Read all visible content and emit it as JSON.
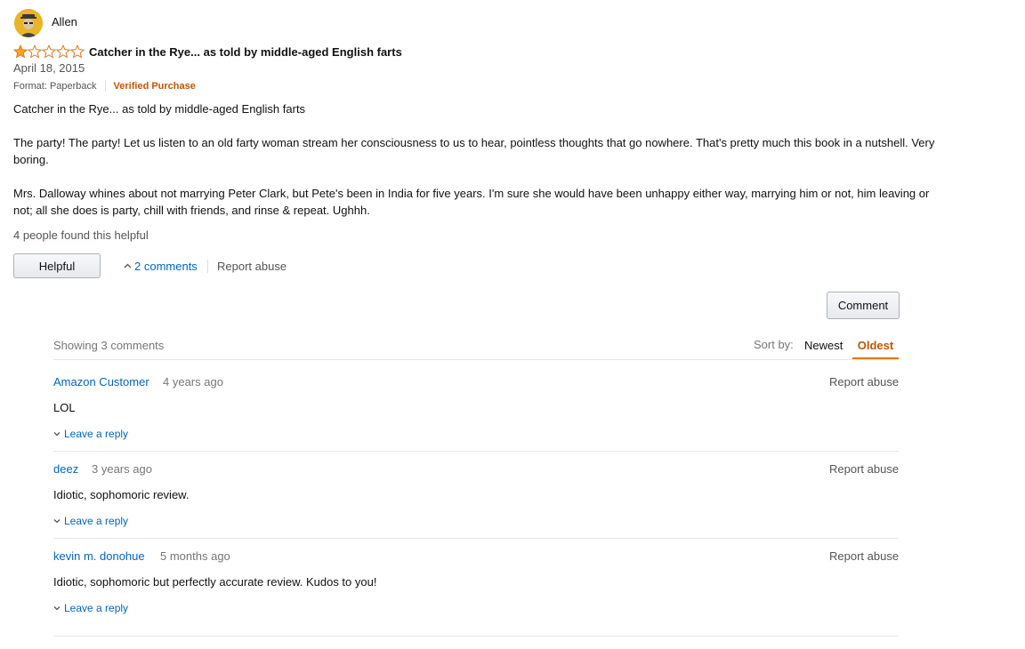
{
  "review": {
    "author": "Allen",
    "rating": 1,
    "max_rating": 5,
    "title": "Catcher in the Rye... as told by middle-aged English farts",
    "date": "April 18, 2015",
    "format": "Format: Paperback",
    "verified": "Verified Purchase",
    "body": [
      "Catcher in the Rye... as told by middle-aged English farts",
      "The party! The party! Let us listen to an old farty woman stream her consciousness to us to hear, pointless thoughts that go nowhere. That's pretty much this book in a nutshell. Very boring.",
      "Mrs. Dalloway whines about not marrying Peter Clark, but Pete's been in India for five years. I'm sure she would have been unhappy either way, marrying him or not, him leaving or not; all she does is party, chill with friends, and rinse & repeat. Ughhh."
    ],
    "helpful_count_text": "4 people found this helpful",
    "helpful_button": "Helpful",
    "comments_link": "2 comments",
    "report_abuse": "Report abuse"
  },
  "comments_section": {
    "comment_button": "Comment",
    "showing": "Showing 3 comments",
    "sort_label": "Sort by:",
    "sort_options": [
      "Newest",
      "Oldest"
    ],
    "sort_selected": "Oldest",
    "comments": [
      {
        "author": "Amazon Customer",
        "time": "4 years ago",
        "text": "LOL",
        "reply": "Leave a reply",
        "report": "Report abuse"
      },
      {
        "author": "deez",
        "time": "3 years ago",
        "text": "Idiotic, sophomoric review.",
        "reply": "Leave a reply",
        "report": "Report abuse"
      },
      {
        "author": "kevin m. donohue",
        "time": "5 months ago",
        "text": "Idiotic, sophomoric but perfectly accurate review. Kudos to you!",
        "reply": "Leave a reply",
        "report": "Report abuse"
      }
    ]
  },
  "colors": {
    "link": "#0066c0",
    "verified": "#c45500",
    "star": "#ffa41c",
    "sort_active": "#c45500"
  }
}
